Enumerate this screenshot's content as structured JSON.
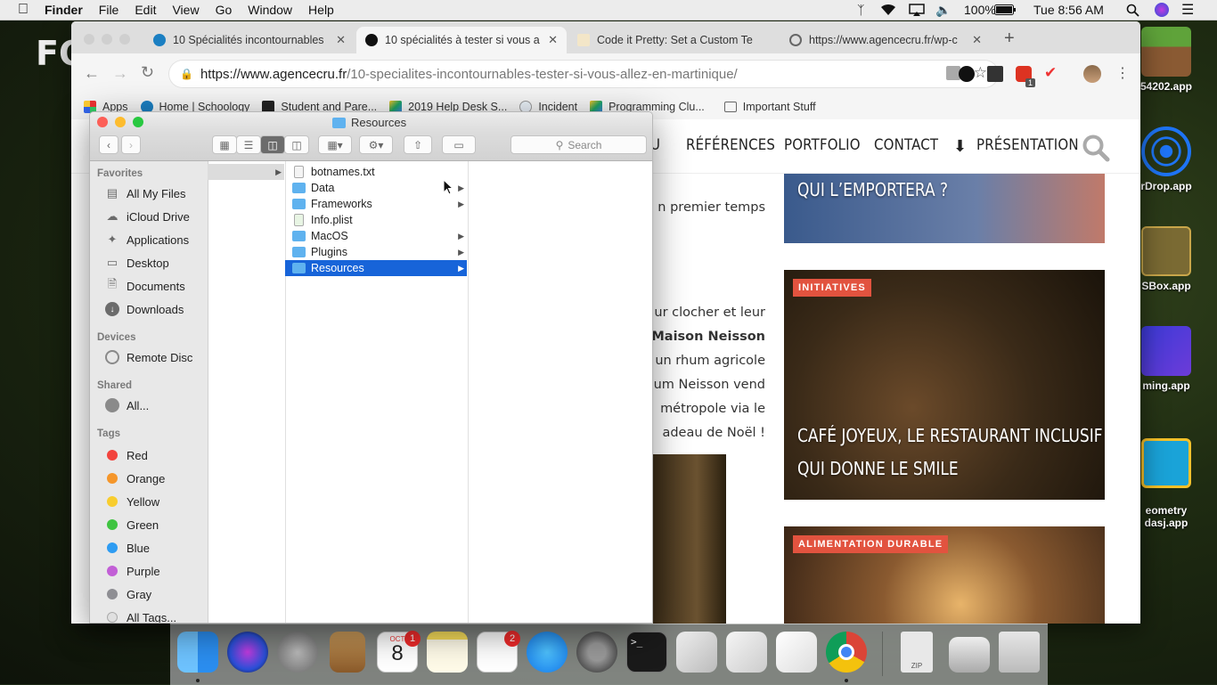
{
  "menubar": {
    "items": [
      "Finder",
      "File",
      "Edit",
      "View",
      "Go",
      "Window",
      "Help"
    ],
    "battery": "100%",
    "clock": "Tue 8:56 AM"
  },
  "desktop": {
    "icons": [
      "54202.app",
      "rDrop.app",
      "SBox.app",
      "ming.app",
      "eometry\ndasj.app"
    ],
    "left_text": "FO"
  },
  "chrome": {
    "tabs": [
      {
        "title": "10 Spécialités incontournables"
      },
      {
        "title": "10 spécialités à tester si vous a"
      },
      {
        "title": "Code it Pretty: Set a Custom Te"
      },
      {
        "title": "https://www.agencecru.fr/wp-c"
      }
    ],
    "url_host": "https://www.agencecru.fr",
    "url_path": "/10-specialites-incontournables-tester-si-vous-allez-en-martinique/",
    "ext_badge": "1",
    "bookmarks": [
      "Apps",
      "Home | Schoology",
      "Student and Pare...",
      "2019 Help Desk S...",
      "Incident",
      "Programming Clu...",
      "Important Stuff"
    ]
  },
  "website": {
    "nav": [
      "U",
      "RÉFÉRENCES",
      "PORTFOLIO",
      "CONTACT",
      "PRÉSENTATION"
    ],
    "text_lines": [
      "n premier temps",
      "ur clocher et leur",
      "a Maison Neisson",
      "un rhum agricole",
      "um Neisson vend",
      "métropole via le",
      "adeau de Noël !"
    ],
    "cards": [
      {
        "badge": "",
        "title_lines": [
          "QUI L’EMPORTERA ?"
        ]
      },
      {
        "badge": "INITIATIVES",
        "title_lines": [
          "CAFÉ JOYEUX, LE RESTAURANT INCLUSIF",
          "QUI DONNE LE SMILE"
        ]
      },
      {
        "badge": "ALIMENTATION DURABLE",
        "title_lines": []
      }
    ]
  },
  "finder": {
    "title": "Resources",
    "search_placeholder": "Search",
    "favorites_label": "Favorites",
    "favorites": [
      "All My Files",
      "iCloud Drive",
      "Applications",
      "Desktop",
      "Documents",
      "Downloads"
    ],
    "devices_label": "Devices",
    "devices": [
      "Remote Disc"
    ],
    "shared_label": "Shared",
    "shared": [
      "All..."
    ],
    "tags_label": "Tags",
    "tags": [
      {
        "name": "Red",
        "color": "#f2433d"
      },
      {
        "name": "Orange",
        "color": "#f5962a"
      },
      {
        "name": "Yellow",
        "color": "#f8cd2e"
      },
      {
        "name": "Green",
        "color": "#3fc441"
      },
      {
        "name": "Blue",
        "color": "#2e9cf2"
      },
      {
        "name": "Purple",
        "color": "#c25fd6"
      },
      {
        "name": "Gray",
        "color": "#8e8e93"
      },
      {
        "name": "All Tags...",
        "color": "#e0e0e0"
      }
    ],
    "files": [
      {
        "name": "botnames.txt",
        "kind": "text",
        "folder": false
      },
      {
        "name": "Data",
        "kind": "folder",
        "folder": true
      },
      {
        "name": "Frameworks",
        "kind": "folder",
        "folder": true
      },
      {
        "name": "Info.plist",
        "kind": "plist",
        "folder": false
      },
      {
        "name": "MacOS",
        "kind": "folder",
        "folder": true
      },
      {
        "name": "Plugins",
        "kind": "folder",
        "folder": true
      },
      {
        "name": "Resources",
        "kind": "folder",
        "folder": true,
        "selected": true
      }
    ]
  },
  "dock": {
    "calendar_month": "OCT",
    "calendar_day": "8",
    "calendar_badge": "1",
    "reminders_badge": "2",
    "zip_label": "ZIP"
  }
}
